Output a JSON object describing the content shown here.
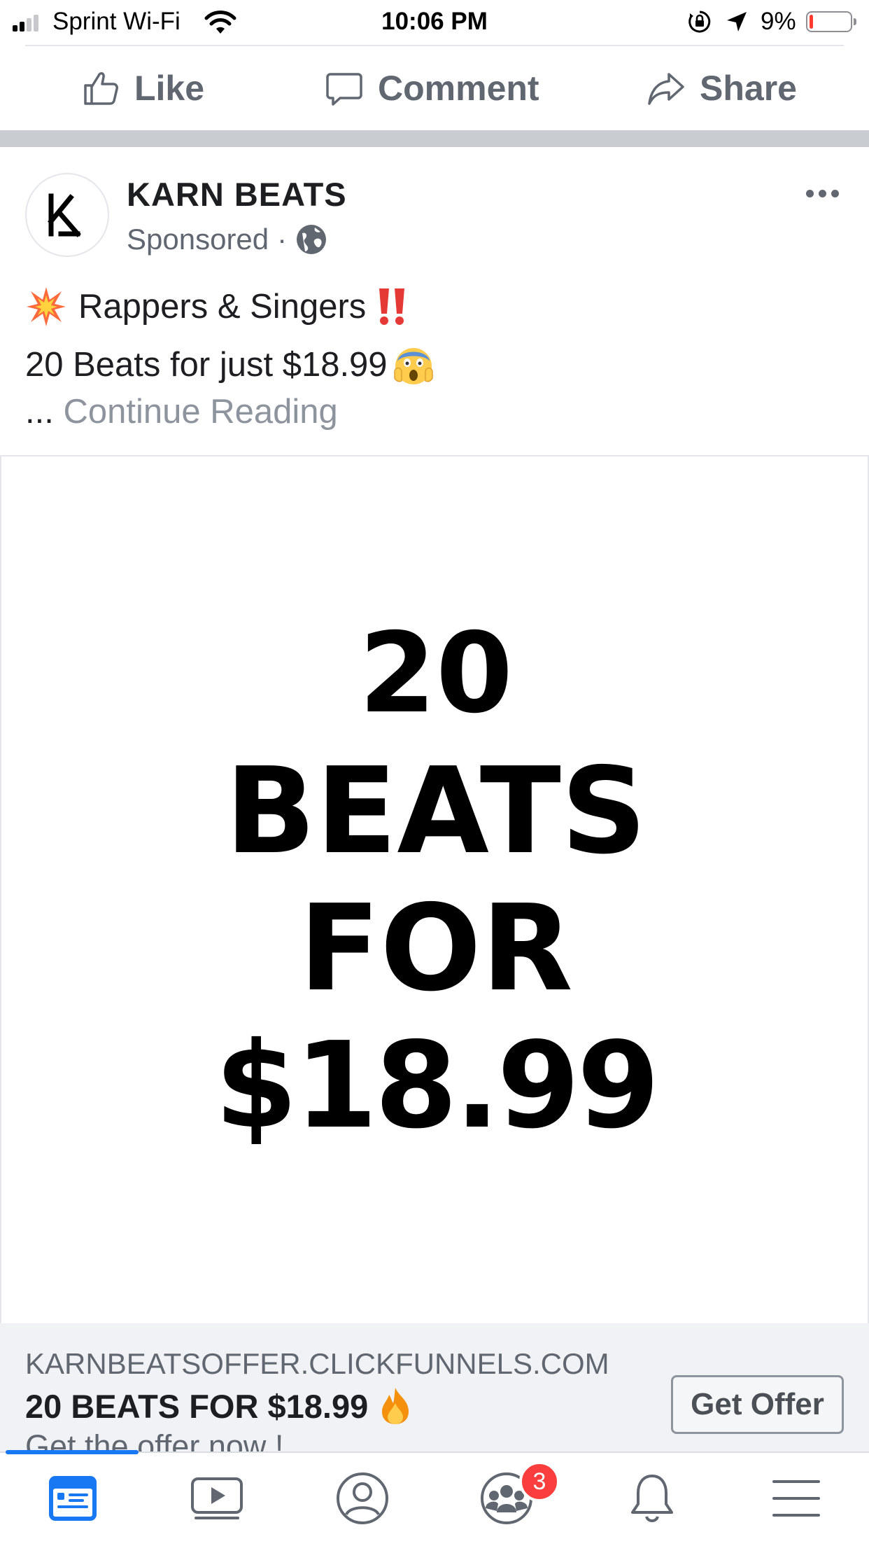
{
  "status_bar": {
    "carrier": "Sprint Wi-Fi",
    "time": "10:06 PM",
    "battery_percent": "9%",
    "battery_level": 0.09,
    "signal_bars": 2
  },
  "actions": {
    "like": "Like",
    "comment": "Comment",
    "share": "Share"
  },
  "post": {
    "page_name": "KARN BEATS",
    "sponsored": "Sponsored",
    "separator": "·",
    "line1": "Rappers & Singers",
    "line2": "20 Beats for just $18.99",
    "ellipsis": "...",
    "continue_reading": "Continue Reading"
  },
  "ad_image": {
    "line1": "20",
    "line2": "BEATS",
    "line3": "FOR",
    "line4": "$18.99"
  },
  "link_preview": {
    "domain": "KARNBEATSOFFER.CLICKFUNNELS.COM",
    "title": "20 BEATS FOR $18.99",
    "description": "Get the offer now !",
    "cta": "Get Offer"
  },
  "tabbar": {
    "groups_badge": "3",
    "active_tab": "news-feed"
  },
  "colors": {
    "accent": "#1877f2",
    "badge": "#fa3e3e",
    "text_secondary": "#606770"
  }
}
